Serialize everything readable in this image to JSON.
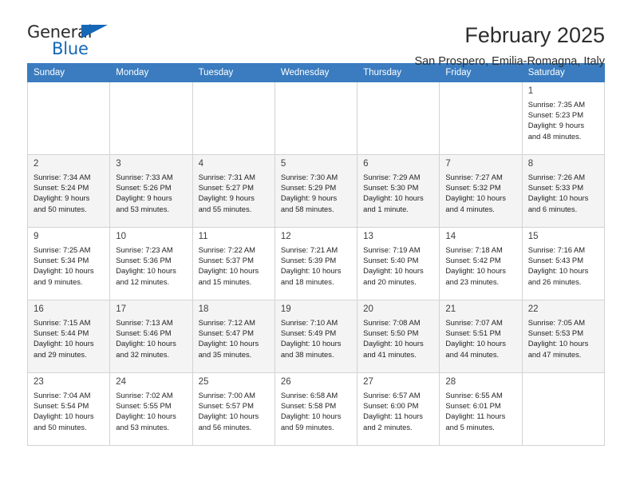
{
  "brand": {
    "name_part1": "General",
    "name_part2": "Blue",
    "accent_color": "#1667b6"
  },
  "header": {
    "title": "February 2025",
    "subtitle": "San Prospero, Emilia-Romagna, Italy"
  },
  "theme": {
    "header_row_bg": "#3a7cbf",
    "header_row_text": "#ffffff",
    "shaded_row_bg": "#f4f4f4",
    "grid_border": "#d3d3d3"
  },
  "weekdays": [
    "Sunday",
    "Monday",
    "Tuesday",
    "Wednesday",
    "Thursday",
    "Friday",
    "Saturday"
  ],
  "weeks": [
    [
      {
        "day": "",
        "info": ""
      },
      {
        "day": "",
        "info": ""
      },
      {
        "day": "",
        "info": ""
      },
      {
        "day": "",
        "info": ""
      },
      {
        "day": "",
        "info": ""
      },
      {
        "day": "",
        "info": ""
      },
      {
        "day": "1",
        "info": "Sunrise: 7:35 AM\nSunset: 5:23 PM\nDaylight: 9 hours\nand 48 minutes."
      }
    ],
    [
      {
        "day": "2",
        "info": "Sunrise: 7:34 AM\nSunset: 5:24 PM\nDaylight: 9 hours\nand 50 minutes."
      },
      {
        "day": "3",
        "info": "Sunrise: 7:33 AM\nSunset: 5:26 PM\nDaylight: 9 hours\nand 53 minutes."
      },
      {
        "day": "4",
        "info": "Sunrise: 7:31 AM\nSunset: 5:27 PM\nDaylight: 9 hours\nand 55 minutes."
      },
      {
        "day": "5",
        "info": "Sunrise: 7:30 AM\nSunset: 5:29 PM\nDaylight: 9 hours\nand 58 minutes."
      },
      {
        "day": "6",
        "info": "Sunrise: 7:29 AM\nSunset: 5:30 PM\nDaylight: 10 hours\nand 1 minute."
      },
      {
        "day": "7",
        "info": "Sunrise: 7:27 AM\nSunset: 5:32 PM\nDaylight: 10 hours\nand 4 minutes."
      },
      {
        "day": "8",
        "info": "Sunrise: 7:26 AM\nSunset: 5:33 PM\nDaylight: 10 hours\nand 6 minutes."
      }
    ],
    [
      {
        "day": "9",
        "info": "Sunrise: 7:25 AM\nSunset: 5:34 PM\nDaylight: 10 hours\nand 9 minutes."
      },
      {
        "day": "10",
        "info": "Sunrise: 7:23 AM\nSunset: 5:36 PM\nDaylight: 10 hours\nand 12 minutes."
      },
      {
        "day": "11",
        "info": "Sunrise: 7:22 AM\nSunset: 5:37 PM\nDaylight: 10 hours\nand 15 minutes."
      },
      {
        "day": "12",
        "info": "Sunrise: 7:21 AM\nSunset: 5:39 PM\nDaylight: 10 hours\nand 18 minutes."
      },
      {
        "day": "13",
        "info": "Sunrise: 7:19 AM\nSunset: 5:40 PM\nDaylight: 10 hours\nand 20 minutes."
      },
      {
        "day": "14",
        "info": "Sunrise: 7:18 AM\nSunset: 5:42 PM\nDaylight: 10 hours\nand 23 minutes."
      },
      {
        "day": "15",
        "info": "Sunrise: 7:16 AM\nSunset: 5:43 PM\nDaylight: 10 hours\nand 26 minutes."
      }
    ],
    [
      {
        "day": "16",
        "info": "Sunrise: 7:15 AM\nSunset: 5:44 PM\nDaylight: 10 hours\nand 29 minutes."
      },
      {
        "day": "17",
        "info": "Sunrise: 7:13 AM\nSunset: 5:46 PM\nDaylight: 10 hours\nand 32 minutes."
      },
      {
        "day": "18",
        "info": "Sunrise: 7:12 AM\nSunset: 5:47 PM\nDaylight: 10 hours\nand 35 minutes."
      },
      {
        "day": "19",
        "info": "Sunrise: 7:10 AM\nSunset: 5:49 PM\nDaylight: 10 hours\nand 38 minutes."
      },
      {
        "day": "20",
        "info": "Sunrise: 7:08 AM\nSunset: 5:50 PM\nDaylight: 10 hours\nand 41 minutes."
      },
      {
        "day": "21",
        "info": "Sunrise: 7:07 AM\nSunset: 5:51 PM\nDaylight: 10 hours\nand 44 minutes."
      },
      {
        "day": "22",
        "info": "Sunrise: 7:05 AM\nSunset: 5:53 PM\nDaylight: 10 hours\nand 47 minutes."
      }
    ],
    [
      {
        "day": "23",
        "info": "Sunrise: 7:04 AM\nSunset: 5:54 PM\nDaylight: 10 hours\nand 50 minutes."
      },
      {
        "day": "24",
        "info": "Sunrise: 7:02 AM\nSunset: 5:55 PM\nDaylight: 10 hours\nand 53 minutes."
      },
      {
        "day": "25",
        "info": "Sunrise: 7:00 AM\nSunset: 5:57 PM\nDaylight: 10 hours\nand 56 minutes."
      },
      {
        "day": "26",
        "info": "Sunrise: 6:58 AM\nSunset: 5:58 PM\nDaylight: 10 hours\nand 59 minutes."
      },
      {
        "day": "27",
        "info": "Sunrise: 6:57 AM\nSunset: 6:00 PM\nDaylight: 11 hours\nand 2 minutes."
      },
      {
        "day": "28",
        "info": "Sunrise: 6:55 AM\nSunset: 6:01 PM\nDaylight: 11 hours\nand 5 minutes."
      },
      {
        "day": "",
        "info": ""
      }
    ]
  ]
}
